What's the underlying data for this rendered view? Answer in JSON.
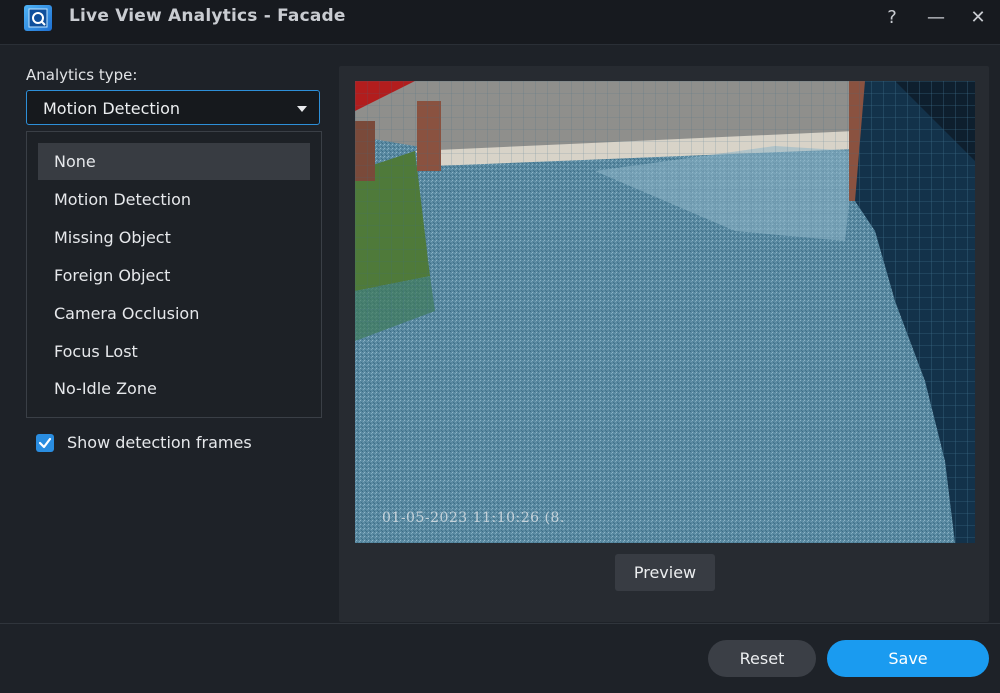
{
  "window": {
    "title": "Live View Analytics - Facade",
    "app_icon": "magnifier-camera-icon",
    "controls": {
      "help": "?",
      "minimize": "—",
      "close": "✕"
    }
  },
  "left_panel": {
    "analytics_label": "Analytics type:",
    "selected_type": "Motion Detection",
    "dropdown_options": [
      "None",
      "Motion Detection",
      "Missing Object",
      "Foreign Object",
      "Camera Occlusion",
      "Focus Lost",
      "No-Idle Zone"
    ],
    "highlighted_option": "None",
    "show_frames_label": "Show detection frames",
    "show_frames_checked": true
  },
  "preview": {
    "timestamp": "01-05-2023 11:10:26  (8.",
    "button_label": "Preview"
  },
  "footer": {
    "reset_label": "Reset",
    "save_label": "Save"
  },
  "colors": {
    "accent": "#1a9bf0",
    "select_border": "#2d8fd8",
    "background": "#1e2228",
    "panel": "#272b31",
    "overlay": "#4e7e95"
  }
}
